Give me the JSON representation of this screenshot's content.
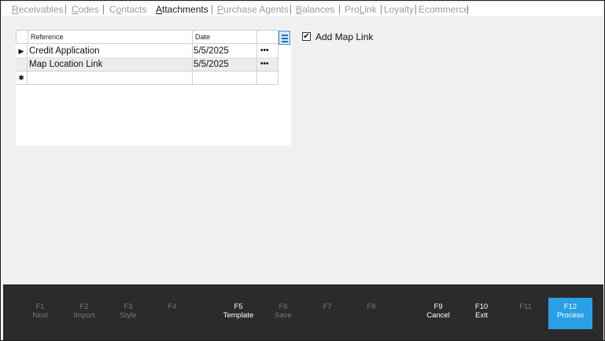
{
  "tabs": [
    {
      "pre": "",
      "u": "R",
      "post": "eceivables",
      "active": false
    },
    {
      "pre": "",
      "u": "C",
      "post": "odes",
      "active": false
    },
    {
      "pre": "C",
      "u": "o",
      "post": "ntacts",
      "active": false
    },
    {
      "pre": "",
      "u": "A",
      "post": "ttachments",
      "active": true
    },
    {
      "pre": "",
      "u": "P",
      "post": "urchase Agents",
      "active": false
    },
    {
      "pre": "",
      "u": "B",
      "post": "alances",
      "active": false
    },
    {
      "pre": "Pro",
      "u": "L",
      "post": "ink",
      "active": false
    },
    {
      "pre": "Loyalty",
      "u": "",
      "post": "",
      "active": false
    },
    {
      "pre": "Ecommerce",
      "u": "",
      "post": "",
      "active": false
    }
  ],
  "grid": {
    "columns": {
      "reference": "Reference",
      "date": "Date"
    },
    "rows": [
      {
        "indicator": "▶",
        "reference": "Credit Application",
        "date": "5/5/2025",
        "action": "•••"
      },
      {
        "indicator": "",
        "reference": "Map Location Link",
        "date": "5/5/2025",
        "action": "•••"
      }
    ],
    "new_row_indicator": "✱"
  },
  "options": {
    "add_map_link_label": "Add Map Link",
    "add_map_link_checked": true,
    "check_glyph": "✔"
  },
  "footer": {
    "keys": [
      {
        "key": "F1",
        "label": "Next",
        "enabled": false
      },
      {
        "key": "F2",
        "label": "Import",
        "enabled": false
      },
      {
        "key": "F3",
        "label": "Style",
        "enabled": false
      },
      {
        "key": "F4",
        "label": "",
        "enabled": false
      },
      {
        "key": "F5",
        "label": "Template",
        "enabled": true
      },
      {
        "key": "F6",
        "label": "Save",
        "enabled": false
      },
      {
        "key": "F7",
        "label": "",
        "enabled": false
      },
      {
        "key": "F8",
        "label": "",
        "enabled": false
      },
      {
        "key": "F9",
        "label": "Cancel",
        "enabled": true
      },
      {
        "key": "F10",
        "label": "Exit",
        "enabled": true
      },
      {
        "key": "F11",
        "label": "",
        "enabled": false
      },
      {
        "key": "F12",
        "label": "Process",
        "enabled": true,
        "primary": true
      }
    ]
  },
  "colors": {
    "primary_key_bg": "#29a0e6",
    "footer_bg": "#2b2b2b",
    "window_bg": "#f0f0f0"
  }
}
